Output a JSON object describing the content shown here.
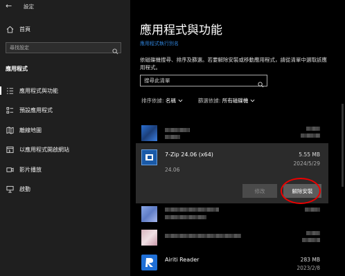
{
  "window": {
    "title": "設定",
    "back_icon": "arrow-left-icon"
  },
  "sidebar": {
    "home_label": "首頁",
    "search_placeholder": "尋找設定",
    "section_title": "應用程式",
    "items": [
      {
        "label": "應用程式與功能",
        "icon": "list-icon",
        "active": true
      },
      {
        "label": "預設應用程式",
        "icon": "defaults-icon"
      },
      {
        "label": "離線地圖",
        "icon": "map-icon"
      },
      {
        "label": "以應用程式開啟網站",
        "icon": "website-icon"
      },
      {
        "label": "影片播放",
        "icon": "video-icon"
      },
      {
        "label": "啟動",
        "icon": "startup-icon"
      }
    ]
  },
  "main": {
    "title": "應用程式與功能",
    "alias_link": "應用程式執行別名",
    "description": "依磁碟機搜尋、排序及篩選。若要解除安裝或移動應用程式，請從清單中選取該應用程式。",
    "list_search_placeholder": "搜尋此清單",
    "sort_label": "排序依據:",
    "sort_value": "名稱",
    "filter_label": "篩選依據:",
    "filter_value": "所有磁碟機",
    "selected_app": {
      "name": "7-Zip 24.06 (x64)",
      "size": "5.55 MB",
      "date": "2024/5/29",
      "version": "24.06",
      "modify_label": "修改",
      "uninstall_label": "解除安裝"
    },
    "last_app": {
      "name": "Airiti Reader",
      "size": "283 MB",
      "date": "2023/2/8"
    }
  },
  "colors": {
    "accent_link": "#2e80d6",
    "highlight_ring": "#e00000",
    "sidebar_bg": "#1f1f1f"
  }
}
